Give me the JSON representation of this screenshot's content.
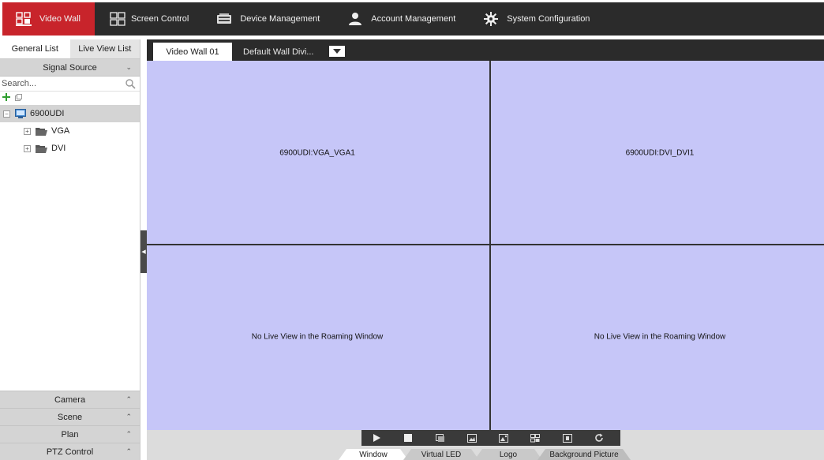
{
  "nav": {
    "items": [
      {
        "label": "Video Wall",
        "icon": "video-wall-icon",
        "active": true
      },
      {
        "label": "Screen Control",
        "icon": "screen-control-icon",
        "active": false
      },
      {
        "label": "Device Management",
        "icon": "device-management-icon",
        "active": false
      },
      {
        "label": "Account Management",
        "icon": "account-icon",
        "active": false
      },
      {
        "label": "System Configuration",
        "icon": "gear-icon",
        "active": false
      }
    ]
  },
  "left_panel": {
    "tabs": [
      {
        "label": "General List",
        "active": true
      },
      {
        "label": "Live View List",
        "active": false
      }
    ],
    "signal_source": {
      "label": "Signal Source"
    },
    "search": {
      "placeholder": "Search..."
    },
    "tree": {
      "device": "6900UDI",
      "children": [
        {
          "label": "VGA"
        },
        {
          "label": "DVI"
        }
      ]
    },
    "bottom_sections": [
      {
        "label": "Camera"
      },
      {
        "label": "Scene"
      },
      {
        "label": "Plan"
      },
      {
        "label": "PTZ Control"
      }
    ]
  },
  "wall_tabs": {
    "tabs": [
      {
        "label": "Video Wall 01",
        "active": true
      },
      {
        "label": "Default Wall Divi...",
        "active": false
      }
    ]
  },
  "wall": {
    "cells": [
      {
        "label": "6900UDI:VGA_VGA1"
      },
      {
        "label": "6900UDI:DVI_DVI1"
      },
      {
        "label": "No Live View in the Roaming Window"
      },
      {
        "label": "No Live View in the Roaming Window"
      }
    ]
  },
  "bottom": {
    "controls": [
      "play-icon",
      "stop-icon",
      "capture-icon",
      "image-icon",
      "picture-icon",
      "layout-icon",
      "fullscreen-icon",
      "refresh-icon"
    ],
    "tabs": [
      {
        "label": "Window",
        "active": true
      },
      {
        "label": "Virtual LED",
        "active": false
      },
      {
        "label": "Logo",
        "active": false
      },
      {
        "label": "Background Picture",
        "active": false
      }
    ]
  },
  "colors": {
    "nav_bg": "#2b2b2b",
    "active_red": "#c8242b",
    "wall_bg": "#c6c6f8",
    "add_green": "#2f9e2f"
  }
}
